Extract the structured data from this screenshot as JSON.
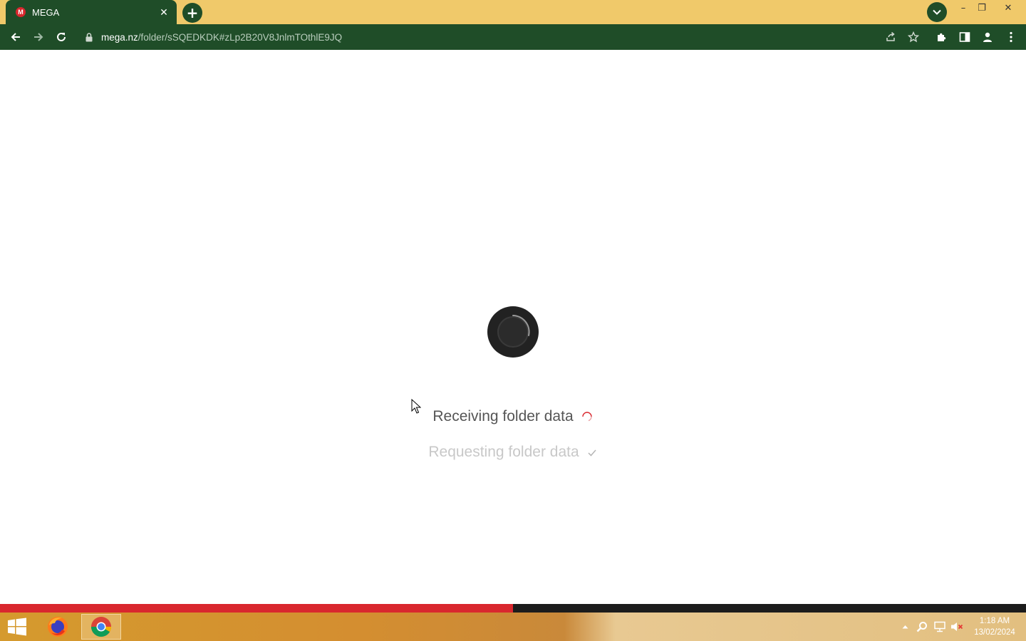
{
  "browser": {
    "tab": {
      "favicon_letter": "M",
      "title": "MEGA",
      "close_glyph": "✕"
    },
    "new_tab_glyph": "+",
    "window_controls": {
      "minimize": "–",
      "maximize": "❐",
      "close": "✕"
    },
    "url": {
      "host": "mega.nz",
      "path": "/folder/sSQEDKDK#zLp2B20V8JnlmTOthlE9JQ"
    },
    "theme": {
      "frame": "#f0c96a",
      "toolbar": "#1f4d28",
      "text": "#ffffff"
    }
  },
  "page": {
    "status_receiving": "Receiving folder data",
    "status_requesting": "Requesting folder data",
    "loading_progress": 0.5,
    "accent_color": "#d9272e"
  },
  "taskbar": {
    "apps": [
      {
        "name": "firefox-icon",
        "active": false
      },
      {
        "name": "chrome-icon",
        "active": true
      }
    ],
    "clock": {
      "time": "1:18 AM",
      "date": "13/02/2024"
    }
  }
}
